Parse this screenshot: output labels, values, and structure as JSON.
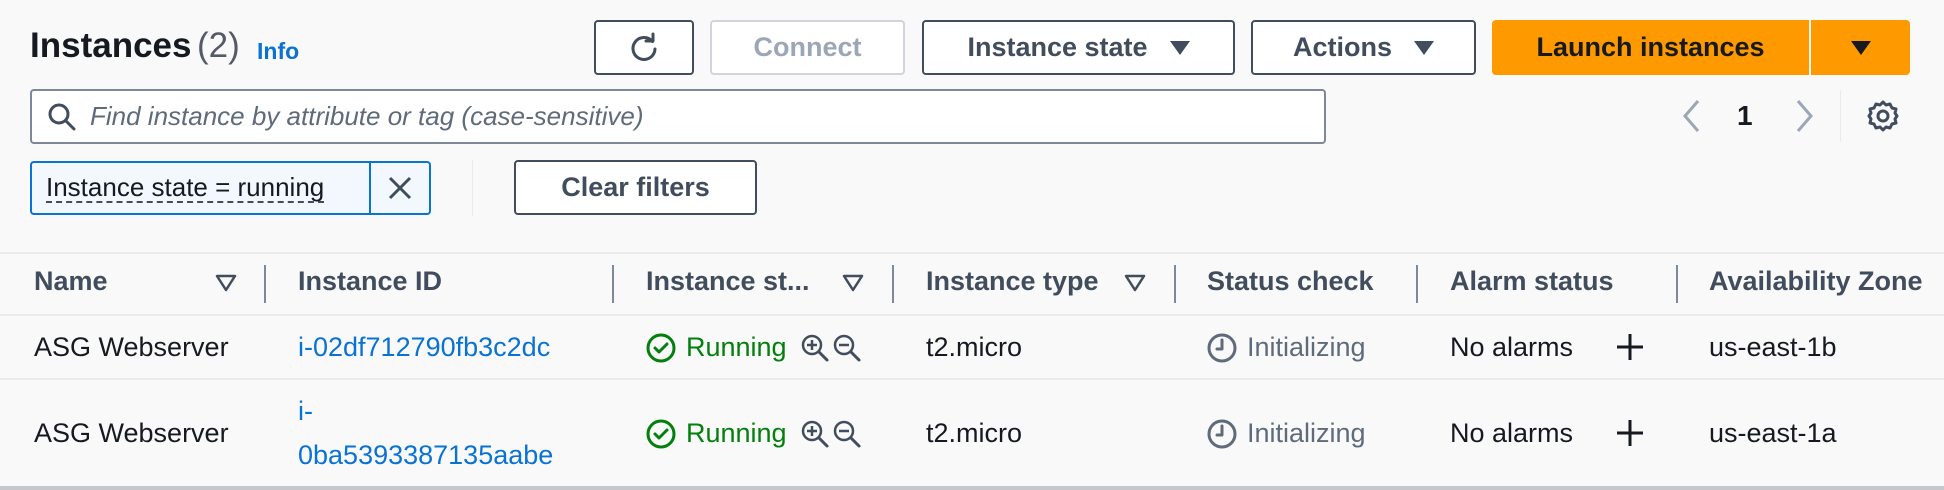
{
  "header": {
    "title": "Instances",
    "count": "(2)",
    "info": "Info"
  },
  "toolbar": {
    "refresh_icon": "refresh-icon",
    "connect": "Connect",
    "instance_state": "Instance state",
    "actions": "Actions",
    "launch": "Launch instances"
  },
  "search": {
    "placeholder": "Find instance by attribute or tag (case-sensitive)",
    "value": ""
  },
  "pagination": {
    "current_page": "1"
  },
  "filter": {
    "token": "Instance state = running",
    "clear": "Clear filters"
  },
  "table": {
    "columns": [
      "Name",
      "Instance ID",
      "Instance st...",
      "Instance type",
      "Status check",
      "Alarm status",
      "Availability Zone"
    ],
    "rows": [
      {
        "name": "ASG Webserver",
        "id": "i-02df712790fb3c2dc",
        "id_line1": "",
        "id_line2": "",
        "state": "Running",
        "type": "t2.micro",
        "status": "Initializing",
        "alarm": "No alarms",
        "az": "us-east-1b"
      },
      {
        "name": "ASG Webserver",
        "id": "i-0ba5393387135aabe",
        "id_line1": "i-",
        "id_line2": "0ba5393387135aabe",
        "state": "Running",
        "type": "t2.micro",
        "status": "Initializing",
        "alarm": "No alarms",
        "az": "us-east-1a"
      }
    ]
  },
  "colors": {
    "accent": "#ff9900",
    "link": "#0972d3",
    "running": "#037f0c",
    "muted": "#5f6b7a"
  }
}
